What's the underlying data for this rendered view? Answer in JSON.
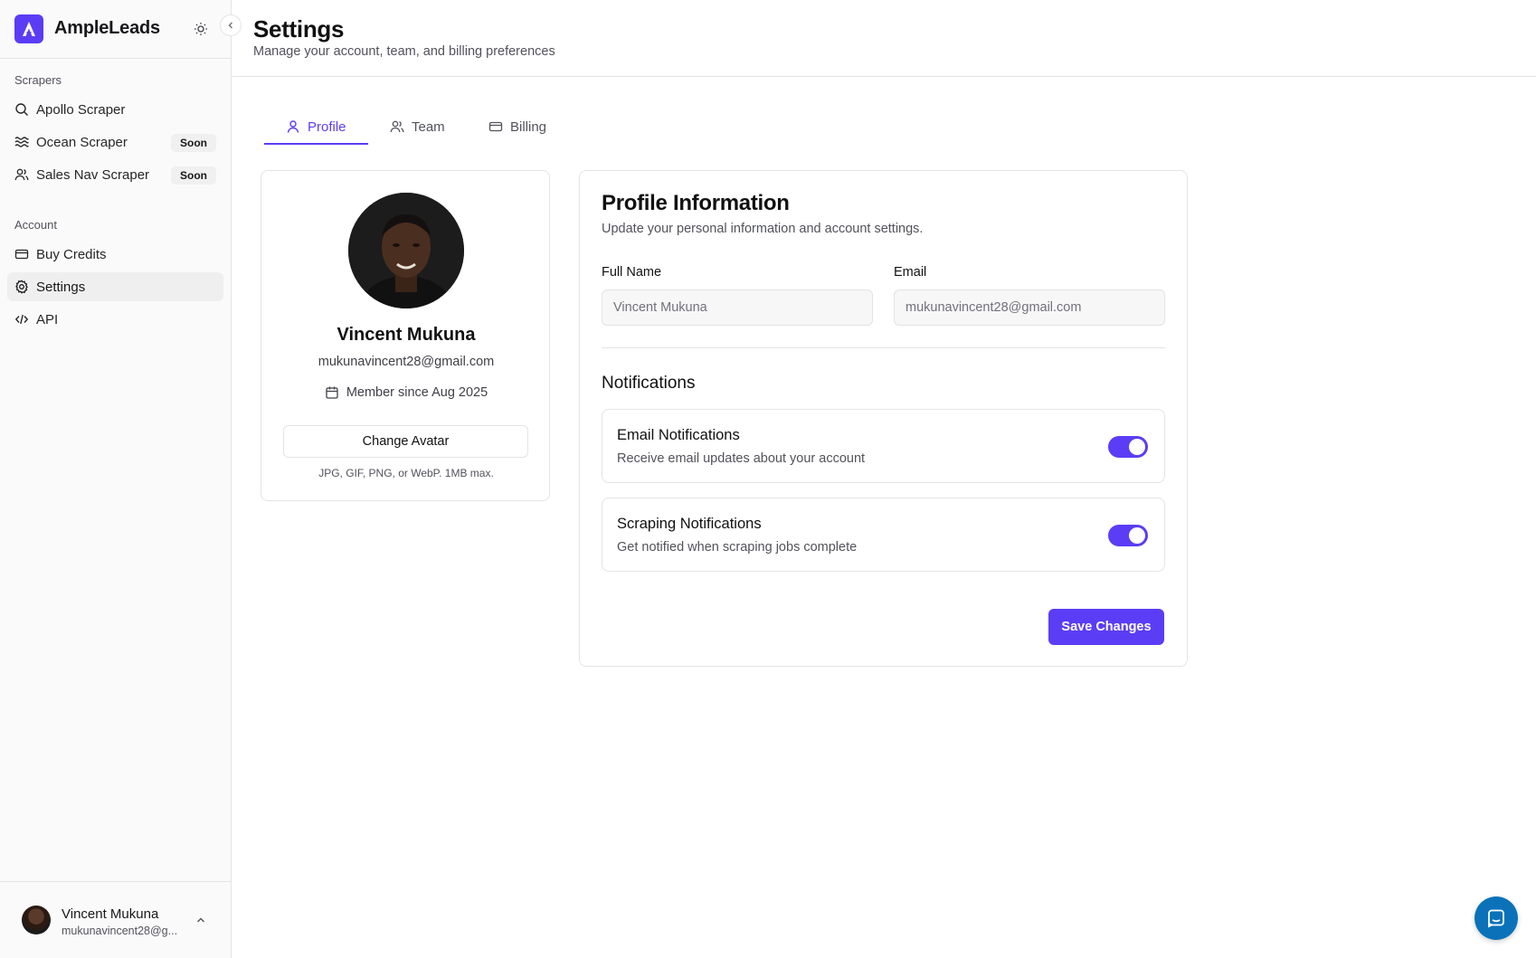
{
  "brand": {
    "name": "AmpleLeads",
    "accent": "#5b3df5"
  },
  "sidebar": {
    "sections": [
      {
        "label": "Scrapers",
        "items": [
          {
            "label": "Apollo Scraper",
            "icon": "search-icon",
            "badge": ""
          },
          {
            "label": "Ocean Scraper",
            "icon": "waves-icon",
            "badge": "Soon"
          },
          {
            "label": "Sales Nav Scraper",
            "icon": "users-icon",
            "badge": "Soon"
          }
        ]
      },
      {
        "label": "Account",
        "items": [
          {
            "label": "Buy Credits",
            "icon": "credit-card-icon",
            "badge": ""
          },
          {
            "label": "Settings",
            "icon": "gear-icon",
            "badge": "",
            "active": true
          },
          {
            "label": "API",
            "icon": "code-icon",
            "badge": ""
          }
        ]
      }
    ],
    "user": {
      "name": "Vincent Mukuna",
      "email": "mukunavincent28@g..."
    }
  },
  "header": {
    "title": "Settings",
    "subtitle": "Manage your account, team, and billing preferences"
  },
  "tabs": [
    {
      "label": "Profile",
      "icon": "user-icon",
      "active": true
    },
    {
      "label": "Team",
      "icon": "users-icon",
      "active": false
    },
    {
      "label": "Billing",
      "icon": "credit-card-icon",
      "active": false
    }
  ],
  "profile_card": {
    "name": "Vincent Mukuna",
    "email": "mukunavincent28@gmail.com",
    "member_since": "Member since Aug 2025",
    "change_avatar_label": "Change Avatar",
    "avatar_hint": "JPG, GIF, PNG, or WebP. 1MB max."
  },
  "profile_info": {
    "title": "Profile Information",
    "subtitle": "Update your personal information and account settings.",
    "full_name_label": "Full Name",
    "full_name_value": "Vincent Mukuna",
    "email_label": "Email",
    "email_value": "mukunavincent28@gmail.com",
    "notifications_heading": "Notifications",
    "notifications": [
      {
        "title": "Email Notifications",
        "description": "Receive email updates about your account",
        "enabled": true
      },
      {
        "title": "Scraping Notifications",
        "description": "Get notified when scraping jobs complete",
        "enabled": true
      }
    ],
    "save_label": "Save Changes"
  },
  "chat": {
    "icon": "chat-icon"
  }
}
